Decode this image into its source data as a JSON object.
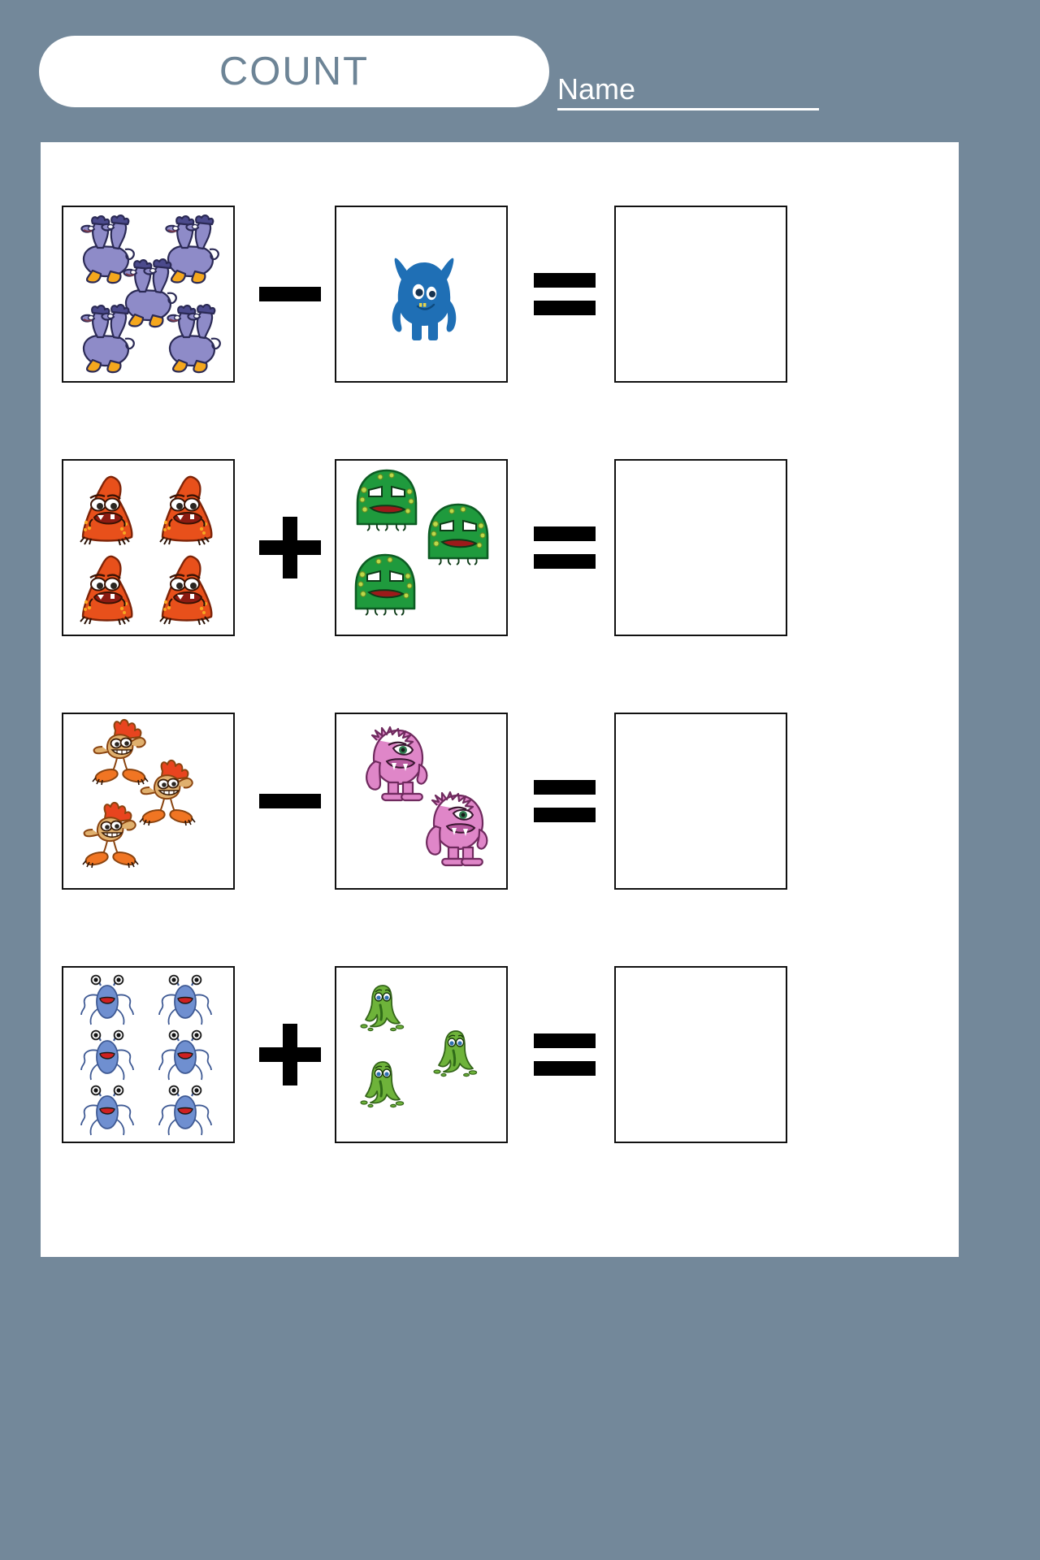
{
  "header": {
    "title": "COUNT",
    "name_label": "Name",
    "title_color": "#6d8496",
    "background_color": "#73889a"
  },
  "worksheet": {
    "type": "math-counting-worksheet",
    "sheet_background": "#ffffff",
    "rows": [
      {
        "index": 1,
        "operator": "minus",
        "operator_symbol": "−",
        "equals_symbol": "=",
        "left_box": {
          "creature": "purple-two-headed-dragon",
          "count": 5,
          "color": "#8e8bc8"
        },
        "right_box": {
          "creature": "blue-horned-monster",
          "count": 1,
          "color": "#1f6fb5"
        },
        "result_box": {
          "value": ""
        }
      },
      {
        "index": 2,
        "operator": "plus",
        "operator_symbol": "+",
        "equals_symbol": "=",
        "left_box": {
          "creature": "red-teardrop-monster",
          "count": 4,
          "color": "#e8501b"
        },
        "right_box": {
          "creature": "green-blob-monster",
          "count": 3,
          "color": "#1f9a3d"
        },
        "result_box": {
          "value": ""
        }
      },
      {
        "index": 3,
        "operator": "minus",
        "operator_symbol": "−",
        "equals_symbol": "=",
        "left_box": {
          "creature": "flame-hair-creature",
          "count": 3,
          "color": "#e8ba78"
        },
        "right_box": {
          "creature": "pink-furry-monster",
          "count": 2,
          "color": "#df86c8"
        },
        "result_box": {
          "value": ""
        }
      },
      {
        "index": 4,
        "operator": "plus",
        "operator_symbol": "+",
        "equals_symbol": "=",
        "left_box": {
          "creature": "blue-bug-monster",
          "count": 6,
          "color": "#6f8fd0"
        },
        "right_box": {
          "creature": "green-slime-monster",
          "count": 3,
          "color": "#6eb33a"
        },
        "result_box": {
          "value": ""
        }
      }
    ]
  }
}
